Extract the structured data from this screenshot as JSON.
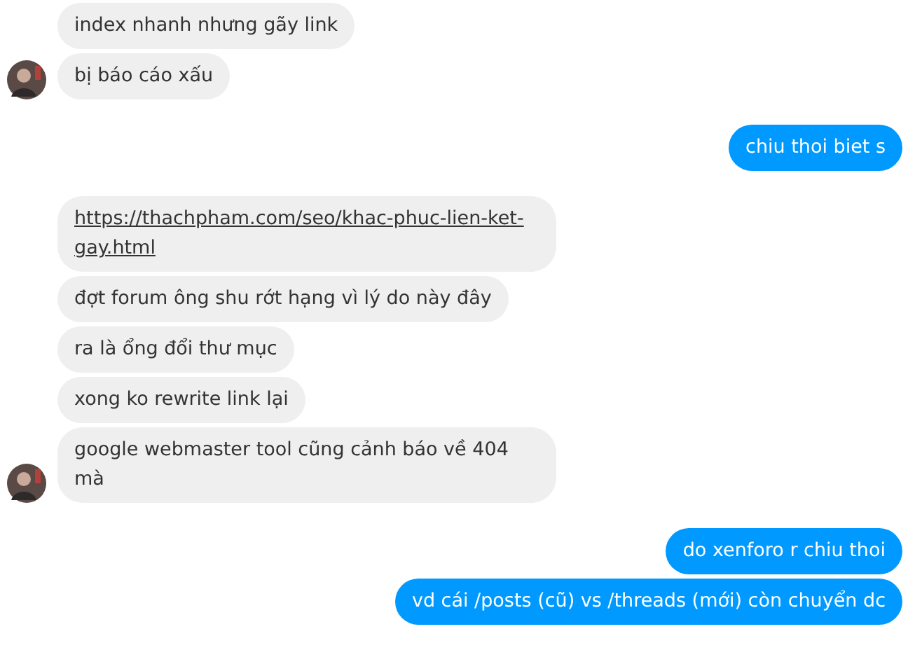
{
  "messages": [
    {
      "kind": "incoming",
      "bubbles": [
        {
          "kind": "text",
          "text": "index nhanh nhưng gãy link"
        },
        {
          "kind": "text",
          "text": "bị báo cáo xấu"
        }
      ]
    },
    {
      "kind": "outgoing",
      "bubbles": [
        {
          "kind": "text",
          "text": "chiu thoi biet s"
        }
      ]
    },
    {
      "kind": "incoming",
      "bubbles": [
        {
          "kind": "link",
          "text": "https://thachpham.com/seo/khac-phuc-lien-ket-gay.html"
        },
        {
          "kind": "text",
          "text": "đợt forum ông shu rớt hạng vì lý do này đây"
        },
        {
          "kind": "text",
          "text": "ra là ổng đổi thư mục"
        },
        {
          "kind": "text",
          "text": "xong ko rewrite link lại"
        },
        {
          "kind": "text",
          "text": "google webmaster tool cũng cảnh báo về 404 mà"
        }
      ]
    },
    {
      "kind": "outgoing",
      "bubbles": [
        {
          "kind": "text",
          "text": "do xenforo r chiu thoi"
        },
        {
          "kind": "text",
          "text": "vd cái /posts (cũ) vs /threads (mới) còn chuyển dc"
        }
      ]
    }
  ]
}
